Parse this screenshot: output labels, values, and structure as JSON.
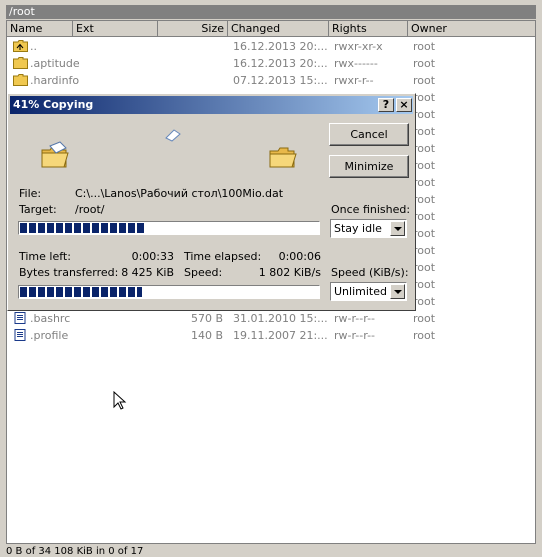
{
  "panel": {
    "path": "/root",
    "columns": [
      "Name",
      "Ext",
      "Size",
      "Changed",
      "Rights",
      "Owner"
    ],
    "rows": [
      {
        "name": "..",
        "size": "",
        "changed": "16.12.2013 20:...",
        "rights": "rwxr-xr-x",
        "owner": "root",
        "type": "up"
      },
      {
        "name": ".aptitude",
        "size": "",
        "changed": "16.12.2013 20:...",
        "rights": "rwx------",
        "owner": "root",
        "type": "folder"
      },
      {
        "name": ".hardinfo",
        "size": "",
        "changed": "07.12.2013 15:...",
        "rights": "rwxr-r--",
        "owner": "root",
        "type": "folder"
      },
      {
        "name": "",
        "size": "",
        "changed": "",
        "rights": "",
        "owner": "root",
        "type": "hidden"
      },
      {
        "name": "",
        "size": "",
        "changed": "",
        "rights": "",
        "owner": "root",
        "type": "hidden"
      },
      {
        "name": "",
        "size": "",
        "changed": "",
        "rights": "",
        "owner": "root",
        "type": "hidden"
      },
      {
        "name": "",
        "size": "",
        "changed": "",
        "rights": "",
        "owner": "root",
        "type": "hidden"
      },
      {
        "name": "",
        "size": "",
        "changed": "",
        "rights": "",
        "owner": "root",
        "type": "hidden"
      },
      {
        "name": "",
        "size": "",
        "changed": "",
        "rights": "",
        "owner": "root",
        "type": "hidden"
      },
      {
        "name": "",
        "size": "",
        "changed": "",
        "rights": "",
        "owner": "root",
        "type": "hidden"
      },
      {
        "name": "",
        "size": "",
        "changed": "",
        "rights": "",
        "owner": "root",
        "type": "hidden"
      },
      {
        "name": "",
        "size": "",
        "changed": "",
        "rights": "",
        "owner": "root",
        "type": "hidden"
      },
      {
        "name": "",
        "size": "",
        "changed": "",
        "rights": "",
        "owner": "root",
        "type": "hidden"
      },
      {
        "name": "",
        "size": "",
        "changed": "",
        "rights": "",
        "owner": "root",
        "type": "hidden"
      },
      {
        "name": "",
        "size": "",
        "changed": "",
        "rights": "",
        "owner": "root",
        "type": "hidden"
      },
      {
        "name": "",
        "size": "",
        "changed": "",
        "rights": "",
        "owner": "root",
        "type": "hidden"
      },
      {
        "name": ".bashrc",
        "size": "570 B",
        "changed": "31.01.2010 15:...",
        "rights": "rw-r--r--",
        "owner": "root",
        "type": "file"
      },
      {
        "name": ".profile",
        "size": "140 B",
        "changed": "19.11.2007 21:...",
        "rights": "rw-r--r--",
        "owner": "root",
        "type": "file"
      }
    ],
    "status": "0 B of 34 108 KiB in 0 of 17"
  },
  "dialog": {
    "title": "41% Copying",
    "help_label": "?",
    "close_label": "×",
    "cancel_label": "Cancel",
    "minimize_label": "Minimize",
    "file_label": "File:",
    "file_value": "C:\\...\\Lanos\\Рабочий стол\\100Mio.dat",
    "target_label": "Target:",
    "target_value": "/root/",
    "once_finished_label": "Once finished:",
    "once_finished_value": "Stay idle",
    "file_progress": 0.42,
    "time_left_label": "Time left:",
    "time_left_value": "0:00:33",
    "time_elapsed_label": "Time elapsed:",
    "time_elapsed_value": "0:00:06",
    "bytes_label": "Bytes transferred:",
    "bytes_value": "8 425 KiB",
    "speed_label": "Speed:",
    "speed_value": "1 802 KiB/s",
    "speed_limit_label": "Speed (KiB/s):",
    "speed_limit_value": "Unlimited",
    "total_progress": 0.41
  }
}
